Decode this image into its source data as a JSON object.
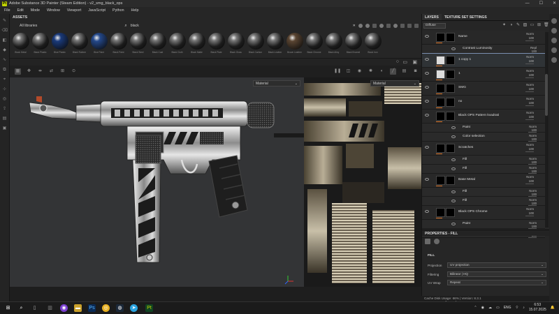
{
  "window": {
    "title": "Adobe Substance 3D Painter (Steam Edition) - v2_smg_black_ops",
    "minimize": "—",
    "maximize": "☐",
    "close": "✕",
    "app_icon": "Pt"
  },
  "menu": [
    "File",
    "Edit",
    "Mode",
    "Window",
    "Viewport",
    "JavaScript",
    "Python",
    "Help"
  ],
  "assets": {
    "header": "ASSETS",
    "library": "All libraries",
    "search_value": "black",
    "items": [
      "Black Metal",
      "Black Plastic",
      "Blue Plastic",
      "Black Rubber",
      "Blue Paint",
      "Black Paint",
      "Black Steel",
      "Black Coat",
      "Black Cloth",
      "Black Matte",
      "Black Plate",
      "Black Gloss",
      "Black Carbon",
      "Black Leather",
      "Brown Leather",
      "Black Chrome",
      "Black Alloy",
      "Black Enamel",
      "Black Iron"
    ]
  },
  "viewport": {
    "material_3d": "Material",
    "material_2d": "Material"
  },
  "right_panel": {
    "tabs": [
      "LAYERS",
      "TEXTURE SET SETTINGS"
    ],
    "channel": "Diffuse",
    "layers": [
      {
        "name": "Name",
        "blend": "Norm",
        "opacity": "100",
        "sub": false
      },
      {
        "name": "Contrast Luminosity",
        "blend": "Repl",
        "opacity": "100",
        "sub": true
      },
      {
        "name": "1 copy 1",
        "blend": "Norm",
        "opacity": "100",
        "sub": false,
        "selected": true
      },
      {
        "name": "1",
        "blend": "Norm",
        "opacity": "100",
        "sub": false
      },
      {
        "name": "SMG",
        "blend": "Norm",
        "opacity": "100",
        "sub": false
      },
      {
        "name": "no",
        "blend": "Norm",
        "opacity": "100",
        "sub": false
      },
      {
        "name": "Black OPS Pattern kvadrati",
        "blend": "Norm",
        "opacity": "100",
        "sub": false
      },
      {
        "name": "Paint",
        "blend": "Norm",
        "opacity": "100",
        "sub": true
      },
      {
        "name": "Color selection",
        "blend": "Norm",
        "opacity": "100",
        "sub": true
      },
      {
        "name": "Scratches",
        "blend": "Norm",
        "opacity": "100",
        "sub": false
      },
      {
        "name": "Fill",
        "blend": "Norm",
        "opacity": "100",
        "sub": true
      },
      {
        "name": "Fill",
        "blend": "Norm",
        "opacity": "100",
        "sub": true
      },
      {
        "name": "Base Metal",
        "blend": "Norm",
        "opacity": "100",
        "sub": false
      },
      {
        "name": "Fill",
        "blend": "Norm",
        "opacity": "100",
        "sub": true
      },
      {
        "name": "Fill",
        "blend": "Norm",
        "opacity": "100",
        "sub": true
      },
      {
        "name": "Black OPS Chrome",
        "blend": "Norm",
        "opacity": "100",
        "sub": false
      },
      {
        "name": "Paint",
        "blend": "Norm",
        "opacity": "100",
        "sub": true
      },
      {
        "name": "Color selection",
        "blend": "Norm",
        "opacity": "100",
        "sub": true
      }
    ],
    "properties": {
      "header": "PROPERTIES - FILL",
      "section": "FILL",
      "rows": [
        {
          "k": "Projection",
          "v": "UV projection"
        },
        {
          "k": "Filtering",
          "v": "Bilinear | HQ"
        },
        {
          "k": "UV Wrap",
          "v": "Repeat"
        }
      ],
      "uv": "UV transformations"
    }
  },
  "status": {
    "cache": "Cache Disk Usage:  66% | Version: 8.3.1"
  },
  "taskbar": {
    "lang": "ENG",
    "time": "6:53",
    "date": "15.07.2025"
  }
}
